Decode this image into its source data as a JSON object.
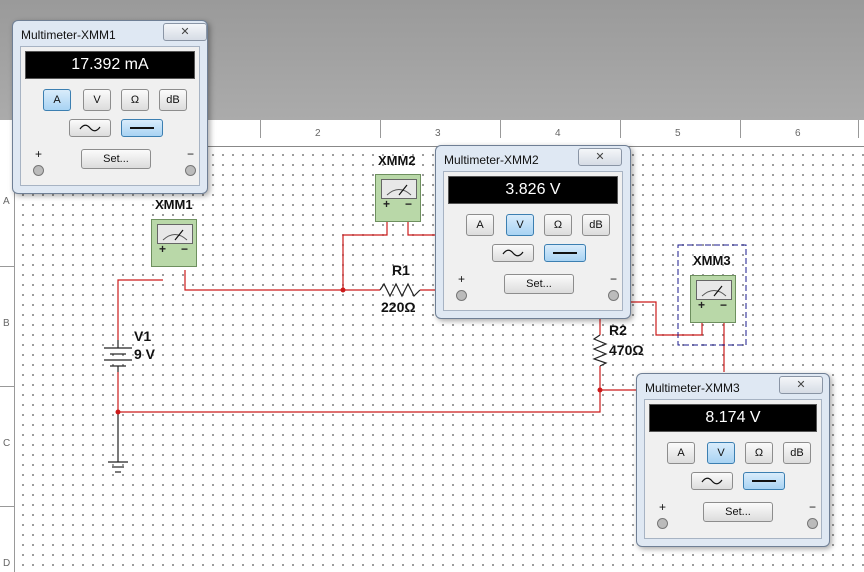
{
  "ruler": {
    "top_labels": [
      "2",
      "3",
      "4",
      "5",
      "6"
    ],
    "left_labels": [
      "A",
      "B",
      "C",
      "D"
    ]
  },
  "circuit": {
    "v1": {
      "name": "V1",
      "value": "9 V"
    },
    "r1": {
      "name": "R1",
      "value": "220Ω"
    },
    "r2": {
      "name": "R2",
      "value": "470Ω"
    },
    "xmm1": {
      "label": "XMM1"
    },
    "xmm2": {
      "label": "XMM2"
    },
    "xmm3": {
      "label": "XMM3"
    }
  },
  "terminal_signs": {
    "plus": "+",
    "minus": "−"
  },
  "windows": {
    "xmm1": {
      "title": "Multimeter-XMM1",
      "reading": "17.392 mA",
      "selected_mode": "A",
      "selected_signal": "DC"
    },
    "xmm2": {
      "title": "Multimeter-XMM2",
      "reading": "3.826 V",
      "selected_mode": "V",
      "selected_signal": "DC"
    },
    "xmm3": {
      "title": "Multimeter-XMM3",
      "reading": "8.174 V",
      "selected_mode": "V",
      "selected_signal": "DC"
    }
  },
  "buttons": {
    "amp": "A",
    "volt": "V",
    "ohm": "Ω",
    "db": "dB",
    "set": "Set...",
    "close": "✕",
    "ac": "AC",
    "dc": "DC"
  },
  "colors": {
    "wire": "#cc1a1a",
    "meter_body": "#b9d8a8",
    "selection_dashed": "#1a1a8c"
  }
}
